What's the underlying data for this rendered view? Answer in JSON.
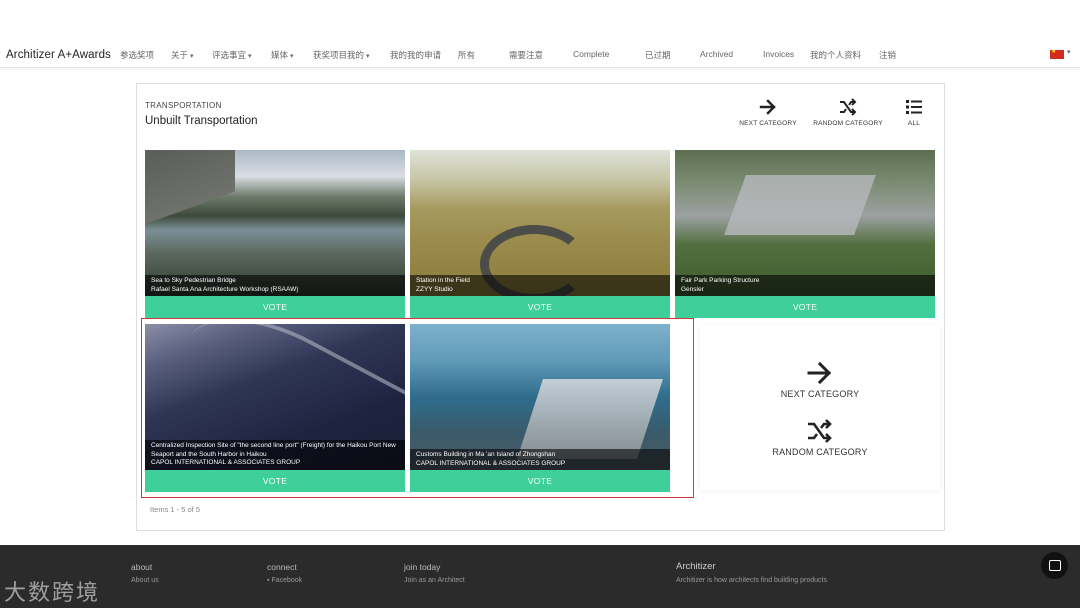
{
  "nav": {
    "brand": "Architizer A+Awards",
    "items": [
      {
        "label": "参选奖项",
        "dropdown": false
      },
      {
        "label": "关于",
        "dropdown": true
      },
      {
        "label": "评选事宜",
        "dropdown": true
      },
      {
        "label": "媒体",
        "dropdown": true
      },
      {
        "label": "获奖项目我的",
        "dropdown": true
      },
      {
        "label": "我的我的申请",
        "dropdown": false
      },
      {
        "label": "所有",
        "dropdown": false
      },
      {
        "label": "需要注意",
        "dropdown": false
      },
      {
        "label": "Complete",
        "dropdown": false
      },
      {
        "label": "已过期",
        "dropdown": false
      },
      {
        "label": "Archived",
        "dropdown": false
      },
      {
        "label": "Invoices",
        "dropdown": false
      },
      {
        "label": "我的个人资料",
        "dropdown": false
      },
      {
        "label": "注销",
        "dropdown": false
      }
    ],
    "caret": "▾"
  },
  "category": {
    "super": "TRANSPORTATION",
    "title": "Unbuilt Transportation"
  },
  "tools": {
    "next": "NEXT CATEGORY",
    "random": "RANDOM CATEGORY",
    "all": "ALL"
  },
  "cards": [
    {
      "title": "Sea to Sky Pedestrian Bridge",
      "author": "Rafael Santa Ana Architecture Workshop (RSAAW)",
      "vote": "VOTE"
    },
    {
      "title": "Station in the Field",
      "author": "ZZYY Studio",
      "vote": "VOTE"
    },
    {
      "title": "Fair Park Parking Structure",
      "author": "Gensler",
      "vote": "VOTE"
    },
    {
      "title": "Centralized Inspection Site of \"the second line port\" (Freight) for the Haikou Port New Seaport and the South Harbor in Haikou",
      "author": "CAPOL INTERNATIONAL & ASSOCIATES GROUP",
      "vote": "VOTE"
    },
    {
      "title": "Customs Building in Ma 'an Island of Zhongshan",
      "author": "CAPOL INTERNATIONAL & ASSOCIATES GROUP",
      "vote": "VOTE"
    }
  ],
  "side_actions": {
    "next": "NEXT CATEGORY",
    "random": "RANDOM CATEGORY"
  },
  "items_count": "Items 1 - 5 of 5",
  "footer": {
    "about": {
      "heading": "about",
      "link": "About us"
    },
    "connect": {
      "heading": "connect",
      "link": "Facebook"
    },
    "join": {
      "heading": "join today",
      "link": "Join as an Architect"
    },
    "brand": "Architizer",
    "tagline": "Architizer is how architects find building products"
  },
  "watermark": "大数跨境",
  "colors": {
    "vote_green": "#3ecf9b",
    "highlight_red": "#d23a3a",
    "footer_bg": "#2b2b2b"
  }
}
